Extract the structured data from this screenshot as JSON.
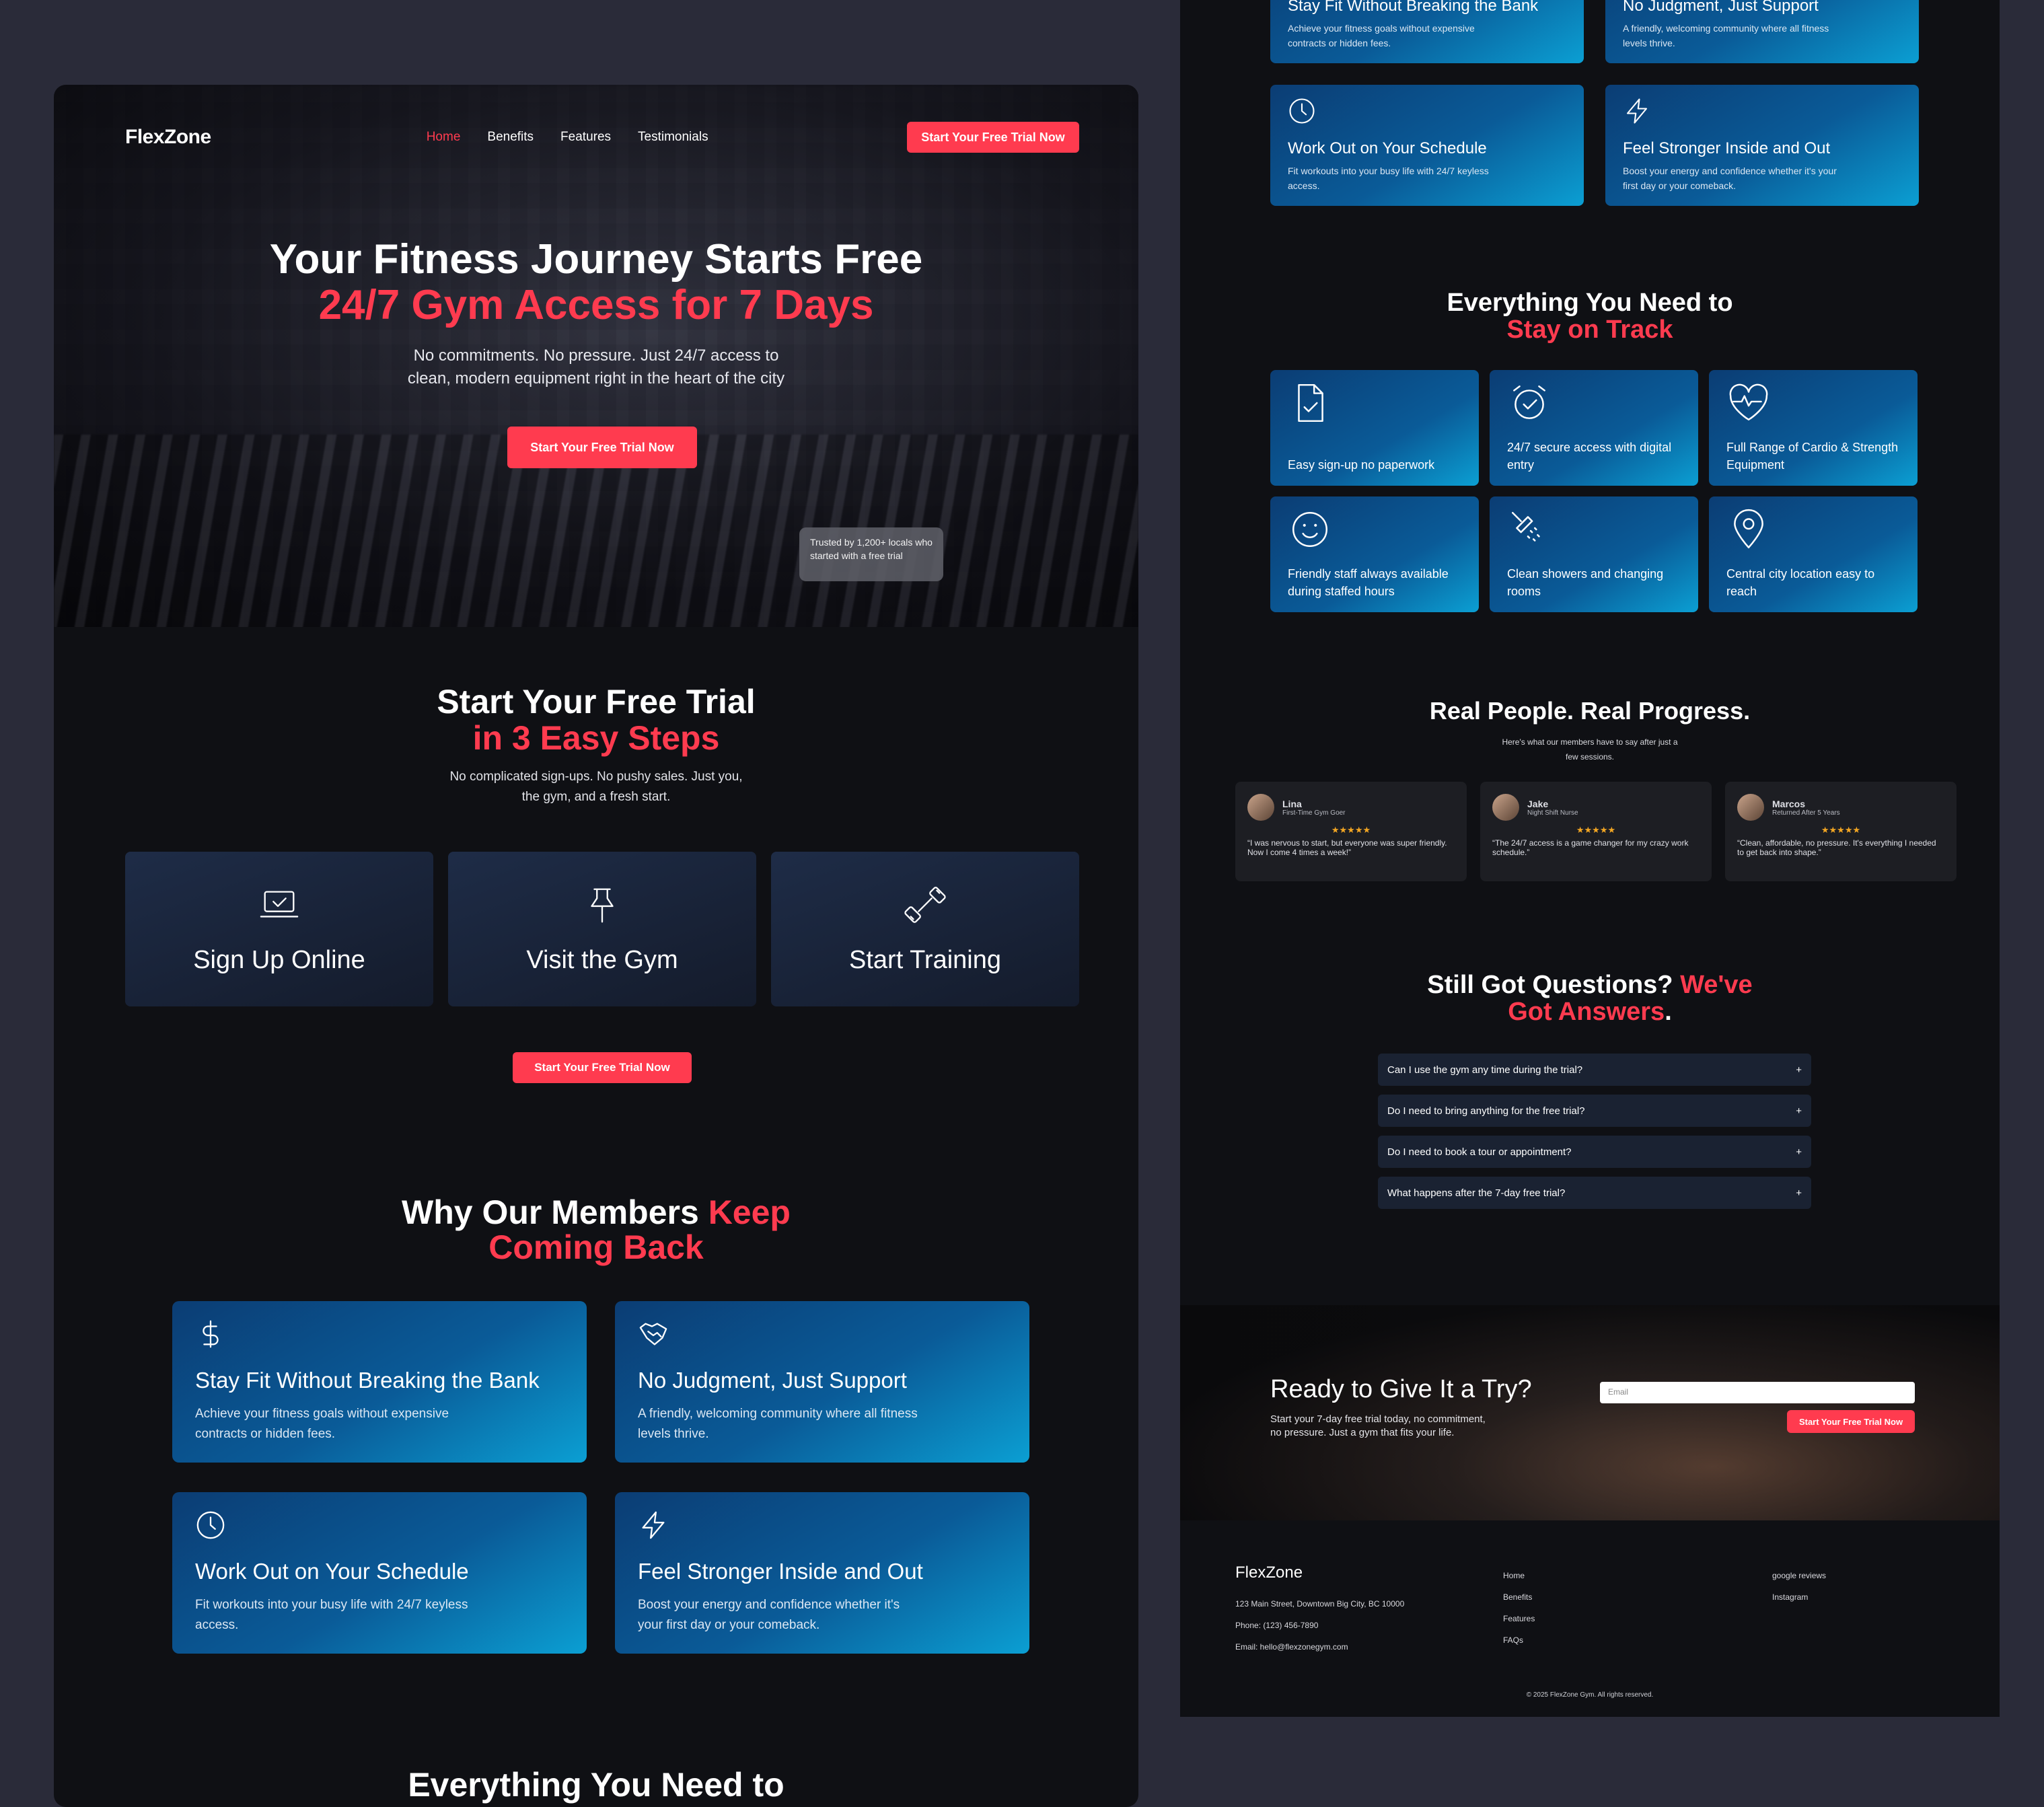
{
  "nav": {
    "logo": "FlexZone",
    "links": [
      "Home",
      "Benefits",
      "Features",
      "Testimonials"
    ],
    "cta": "Start Your Free Trial Now"
  },
  "hero": {
    "title_line1": "Your Fitness Journey Starts Free",
    "title_line2": "24/7 Gym Access for 7 Days",
    "subtitle_line1": "No commitments. No pressure. Just 24/7 access to",
    "subtitle_line2": "clean, modern equipment right in the heart of the city",
    "cta": "Start Your Free Trial Now",
    "trust": "Trusted by 1,200+ locals who started with a free trial"
  },
  "steps_section": {
    "title_line1": "Start Your Free Trial",
    "title_line2": "in 3 Easy Steps",
    "subtitle_line1": "No complicated sign-ups. No pushy sales. Just you,",
    "subtitle_line2": "the gym, and a fresh start.",
    "steps": [
      {
        "label": "Sign Up Online",
        "icon": "laptop-check-icon"
      },
      {
        "label": "Visit the Gym",
        "icon": "pin-icon"
      },
      {
        "label": "Start Training",
        "icon": "dumbbell-icon"
      }
    ],
    "cta": "Start Your Free Trial Now"
  },
  "why_section": {
    "title_white": "Why Our Members",
    "title_red1": "Keep",
    "title_red2": "Coming Back",
    "cards": [
      {
        "icon": "dollar-icon",
        "title": "Stay Fit Without Breaking the Bank",
        "desc": "Achieve your fitness goals without expensive contracts or hidden fees."
      },
      {
        "icon": "handshake-icon",
        "title": "No Judgment, Just Support",
        "desc": "A friendly, welcoming community where all fitness levels thrive."
      },
      {
        "icon": "clock-icon",
        "title": "Work Out on Your Schedule",
        "desc": "Fit workouts into your busy life with 24/7 keyless access."
      },
      {
        "icon": "lightning-icon",
        "title": "Feel Stronger Inside and Out",
        "desc": "Boost your energy and confidence whether it's your first day or your comeback."
      }
    ],
    "next_heading_partial": "Everything You Need to"
  },
  "features_section": {
    "title_line1": "Everything You Need to",
    "title_line2": "Stay on Track",
    "items": [
      {
        "icon": "document-check-icon",
        "label": "Easy sign-up no paperwork"
      },
      {
        "icon": "alarm-clock-icon",
        "label": "24/7 secure access with digital entry"
      },
      {
        "icon": "heart-pulse-icon",
        "label": "Full Range of Cardio & Strength Equipment"
      },
      {
        "icon": "smile-icon",
        "label": "Friendly staff always available during staffed hours"
      },
      {
        "icon": "shower-icon",
        "label": "Clean showers and changing rooms"
      },
      {
        "icon": "location-pin-icon",
        "label": "Central city location easy to reach"
      }
    ]
  },
  "testimonials": {
    "title": "Real People. Real Progress.",
    "subtitle_line1": "Here's what our members have to say after just a",
    "subtitle_line2": "few sessions.",
    "items": [
      {
        "name": "Lina",
        "role": "First-Time Gym Goer",
        "stars": "★★★★★",
        "quote": "“I was nervous to start, but everyone was super friendly. Now I come 4 times a week!”"
      },
      {
        "name": "Jake",
        "role": "Night Shift Nurse",
        "stars": "★★★★★",
        "quote": "“The 24/7 access is a game changer for my crazy work schedule.”"
      },
      {
        "name": "Marcos",
        "role": "Returned After 5 Years",
        "stars": "★★★★★",
        "quote": "“Clean, affordable, no pressure. It's everything I needed to get back into shape.”"
      }
    ]
  },
  "faq": {
    "title_white": "Still Got Questions?",
    "title_red1": "We've",
    "title_red2": "Got Answers",
    "title_dot": ".",
    "questions": [
      "Can I use the gym any time during the trial?",
      "Do I need to bring anything for the free trial?",
      "Do I need to book a tour or appointment?",
      "What happens after the 7-day free trial?"
    ],
    "expand": "+"
  },
  "cta_section": {
    "title": "Ready to Give It a Try?",
    "desc": "Start your 7-day free trial today, no commitment, no pressure. Just a gym that fits your life.",
    "email_placeholder": "Email",
    "button": "Start Your Free Trial Now"
  },
  "footer": {
    "brand": "FlexZone",
    "address": "123 Main Street, Downtown Big City, BC 10000",
    "phone": "Phone: (123) 456-7890",
    "email": "Email: hello@flexzonegym.com",
    "links": [
      "Home",
      "Benefits",
      "Features",
      "FAQs"
    ],
    "social": [
      "google reviews",
      "Instagram"
    ],
    "copyright": "© 2025 FlexZone Gym. All rights reserved."
  }
}
